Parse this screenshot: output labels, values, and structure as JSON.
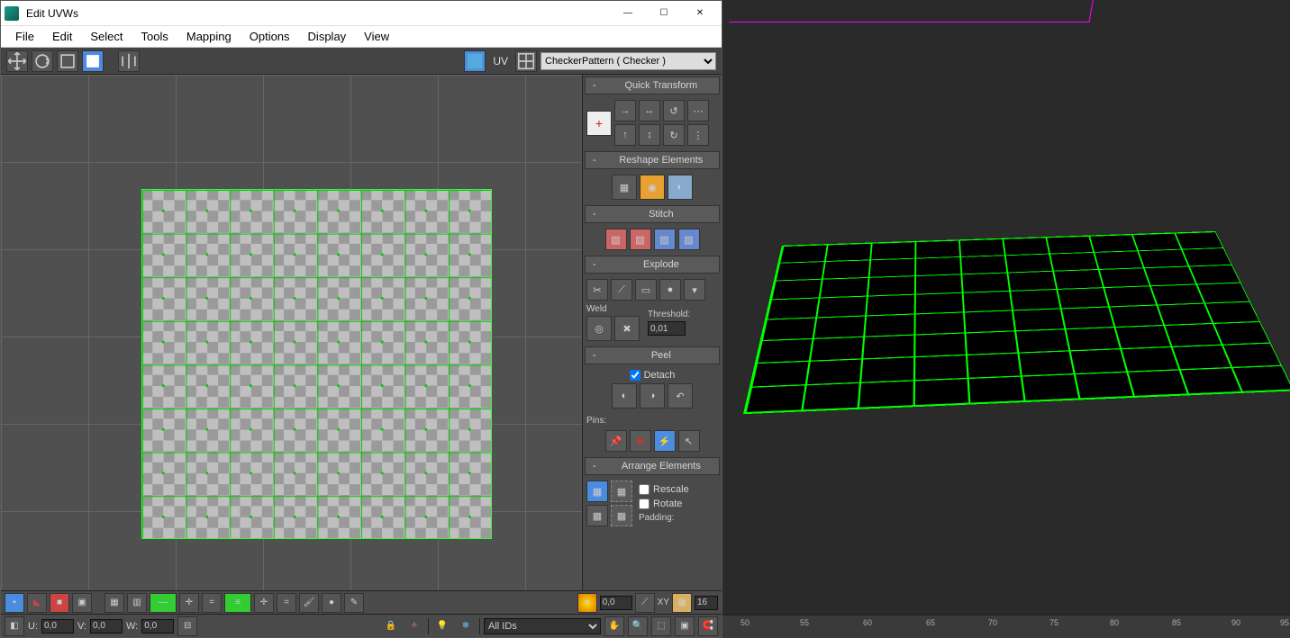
{
  "window": {
    "title": "Edit UVWs"
  },
  "menu": {
    "items": [
      "File",
      "Edit",
      "Select",
      "Tools",
      "Mapping",
      "Options",
      "Display",
      "View"
    ]
  },
  "toolbar": {
    "uv_label": "UV",
    "dropdown_selected": "CheckerPattern  ( Checker )"
  },
  "rollouts": {
    "quick_transform": "Quick Transform",
    "reshape": "Reshape Elements",
    "stitch": "Stitch",
    "explode": "Explode",
    "weld": "Weld",
    "threshold_label": "Threshold:",
    "threshold_value": "0,01",
    "peel": "Peel",
    "detach": "Detach",
    "pins": "Pins:",
    "arrange": "Arrange Elements",
    "rescale": "Rescale",
    "rotate": "Rotate",
    "padding": "Padding:"
  },
  "status1": {
    "softsel_value": "0,0",
    "xy_label": "XY",
    "tile_value": "16"
  },
  "status2": {
    "u_label": "U:",
    "u_val": "0,0",
    "v_label": "V:",
    "v_val": "0,0",
    "w_label": "W:",
    "w_val": "0,0",
    "ids_label": "All IDs"
  },
  "ruler": {
    "ticks": [
      "50",
      "55",
      "60",
      "65",
      "70",
      "75",
      "80",
      "85",
      "90",
      "95"
    ]
  }
}
